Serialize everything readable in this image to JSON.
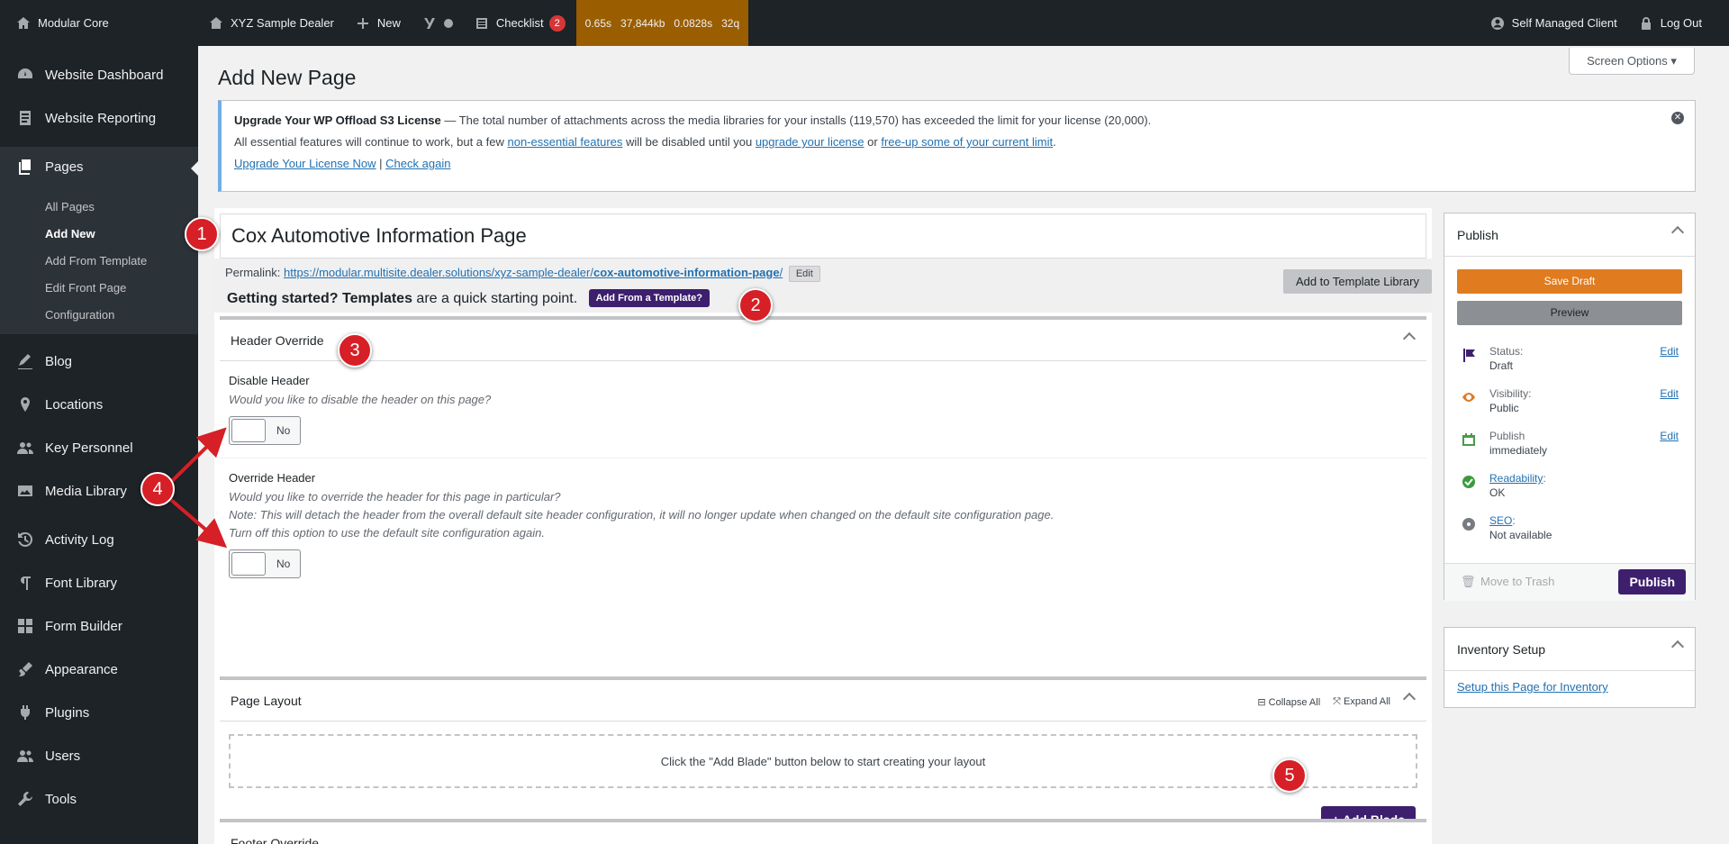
{
  "adminbar": {
    "site": "Modular Core",
    "dealer": "XYZ Sample Dealer",
    "new": "New",
    "checklist": "Checklist",
    "checklist_count": "2",
    "perf": [
      "0.65s",
      "37,844kb",
      "0.0828s",
      "32q"
    ],
    "user": "Self Managed Client",
    "logout": "Log Out"
  },
  "sidebar": {
    "items_top": [
      {
        "label": "Website Dashboard",
        "icon": "dashboard-icon"
      },
      {
        "label": "Website Reporting",
        "icon": "report-icon"
      }
    ],
    "pages": "Pages",
    "submenu": [
      "All Pages",
      "Add New",
      "Add From Template",
      "Edit Front Page",
      "Configuration"
    ],
    "items_bottom": [
      {
        "label": "Blog",
        "icon": "blog-icon"
      },
      {
        "label": "Locations",
        "icon": "location-icon"
      },
      {
        "label": "Key Personnel",
        "icon": "people-icon"
      },
      {
        "label": "Media Library",
        "icon": "media-icon"
      },
      {
        "label": "Activity Log",
        "icon": "history-icon"
      },
      {
        "label": "Font Library",
        "icon": "font-icon"
      },
      {
        "label": "Form Builder",
        "icon": "form-icon"
      },
      {
        "label": "Appearance",
        "icon": "brush-icon"
      },
      {
        "label": "Plugins",
        "icon": "plugin-icon"
      },
      {
        "label": "Users",
        "icon": "users-icon"
      },
      {
        "label": "Tools",
        "icon": "wrench-icon"
      }
    ]
  },
  "page": {
    "title": "Add New Page",
    "screen_options": "Screen Options ▾"
  },
  "notice": {
    "heading": "Upgrade Your WP Offload S3 License",
    "line1": " — The total number of attachments across the media libraries for your installs (119,570) has exceeded the limit for your license (20,000).",
    "line2a": "All essential features will continue to work, but a few ",
    "link_nonessential": "non-essential features",
    "line2b": " will be disabled until you ",
    "link_upgrade": "upgrade your license",
    "line2c": " or ",
    "link_freeup": "free-up some of your current limit",
    "line2d": ".",
    "link_upgrade_now": "Upgrade Your License Now",
    "sep": " | ",
    "link_check": "Check again"
  },
  "editor": {
    "post_title": "Cox Automotive Information Page",
    "permalink_label": "Permalink:",
    "permalink_base": "https://modular.multisite.dealer.solutions/xyz-sample-dealer/",
    "permalink_slug": "cox-automotive-information-page",
    "permalink_end": "/",
    "edit": "Edit",
    "getting_started_bold": "Getting started? Templates",
    "getting_started_rest": " are a quick starting point.",
    "add_from_template": "Add From a Template?",
    "add_to_library": "Add to Template Library"
  },
  "header_override": {
    "title": "Header Override",
    "disable_label": "Disable Header",
    "disable_desc": "Would you like to disable the header on this page?",
    "toggle_no": "No",
    "override_label": "Override Header",
    "override_desc1": "Would you like to override the header for this page in particular?",
    "override_desc2": "Note: This will detach the header from the overall default site header configuration, it will no longer update when changed on the default site configuration page.",
    "override_desc3": "Turn off this option to use the default site configuration again."
  },
  "page_layout": {
    "title": "Page Layout",
    "collapse_all": "Collapse All",
    "expand_all": "Expand All",
    "empty": "Click the \"Add Blade\" button below to start creating your layout",
    "add_blade": "+ Add Blade"
  },
  "footer_override": {
    "title": "Footer Override"
  },
  "publish": {
    "title": "Publish",
    "save_draft": "Save Draft",
    "preview": "Preview",
    "status_label": "Status:",
    "status_value": "Draft",
    "visibility_label": "Visibility:",
    "visibility_value": "Public",
    "publish_label": "Publish",
    "publish_value": "immediately",
    "readability_label": "Readability",
    "readability_value": "OK",
    "seo_label": "SEO",
    "seo_value": "Not available",
    "edit": "Edit",
    "trash": "Move to Trash",
    "publish_button": "Publish"
  },
  "inventory": {
    "title": "Inventory Setup",
    "link": "Setup this Page for Inventory"
  },
  "callouts": [
    "1",
    "2",
    "3",
    "4",
    "5"
  ],
  "colors": {
    "admin_bg": "#1d2327",
    "accent_purple": "#3d1f6e",
    "save_draft": "#e07b1f",
    "callout": "#d61f26"
  }
}
